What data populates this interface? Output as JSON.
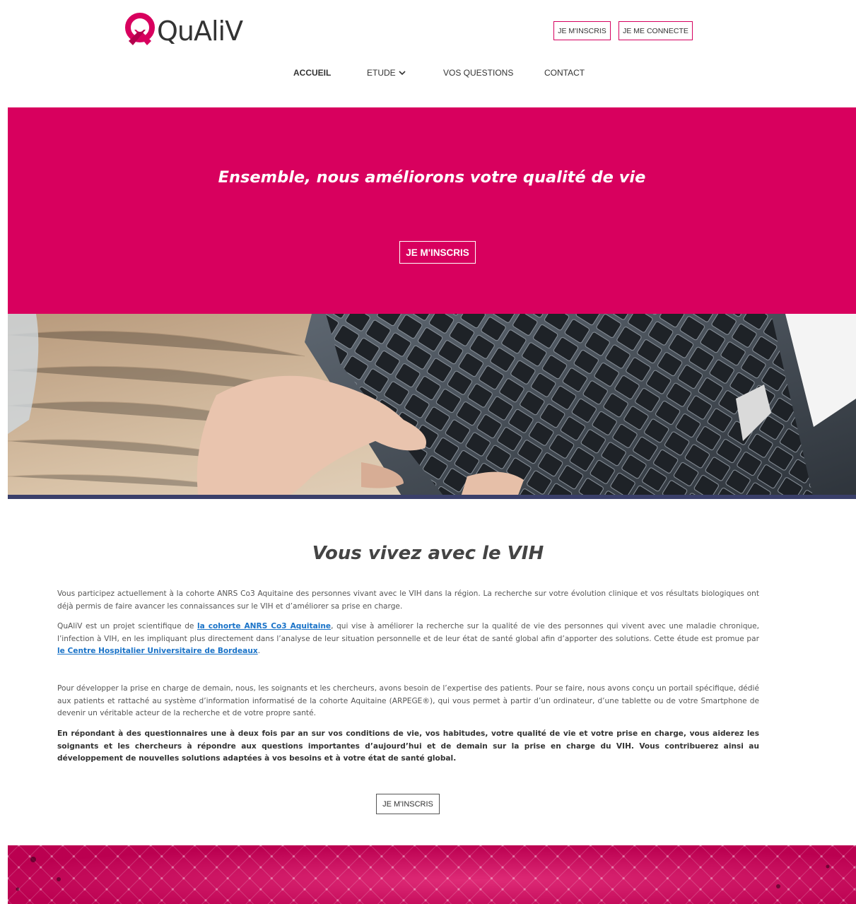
{
  "brand": {
    "name": "QuAliV",
    "accent": "#d8005e"
  },
  "header": {
    "register_label": "JE M'INSCRIS",
    "login_label": "JE ME CONNECTE"
  },
  "nav": {
    "items": [
      {
        "label": "ACCUEIL",
        "active": true
      },
      {
        "label": "ETUDE",
        "active": false,
        "icon": "chevron-down-icon"
      },
      {
        "label": "VOS QUESTIONS",
        "active": false
      },
      {
        "label": "CONTACT",
        "active": false
      }
    ]
  },
  "hero": {
    "title": "Ensemble, nous améliorons votre qualité de vie",
    "button_label": "JE M'INSCRIS"
  },
  "content": {
    "title": "Vous vivez avec le VIH",
    "p1": "Vous participez actuellement à la cohorte ANRS Co3 Aquitaine des personnes vivant avec le VIH dans la région. La recherche sur votre évolution clinique et vos résultats biologiques ont déjà permis de faire avancer les connaissances sur le VIH et d’améliorer sa prise en charge.",
    "p2_a": "QuAliV est un projet scientifique de ",
    "p2_link1": "la cohorte ANRS Co3 Aquitaine",
    "p2_b": ", qui vise à améliorer la recherche sur la qualité de vie des personnes qui vivent avec une maladie chronique, l’infection à VIH, en les impliquant plus directement dans l’analyse de leur situation personnelle et de leur état de santé global afin d’apporter des solutions. Cette étude est promue par ",
    "p2_link2": "le Centre Hospitalier Universitaire de Bordeaux",
    "p2_c": ".",
    "p3": "Pour développer la prise en charge de demain, nous, les soignants et les chercheurs, avons besoin de l’expertise des patients. Pour se faire, nous avons conçu un portail spécifique, dédié aux patients et rattaché au système d’information informatisé de la cohorte Aquitaine (ARPEGE®), qui vous permet à partir d’un ordinateur, d’une tablette ou de votre Smartphone de devenir un véritable acteur de la recherche et de votre propre santé.",
    "p4": "En répondant à des questionnaires une à deux fois par an sur vos conditions de vie, vos habitudes, votre qualité de vie et votre prise en charge, vous aiderez les soignants et les chercheurs à répondre aux questions importantes d’aujourd’hui et de demain sur la prise en charge du VIH. Vous contribuerez ainsi au développement de nouvelles solutions adaptées à vos besoins et à votre état de santé global.",
    "button_label": "JE M'INSCRIS"
  }
}
